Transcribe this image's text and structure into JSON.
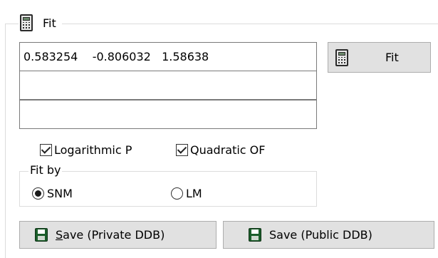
{
  "group": {
    "title": "Fit"
  },
  "fields": [
    {
      "value": "0.583254    -0.806032   1.58638"
    },
    {
      "value": ""
    },
    {
      "value": ""
    }
  ],
  "fit_button": {
    "label": "Fit"
  },
  "checkboxes": [
    {
      "label": "Logarithmic P",
      "checked": true
    },
    {
      "label": "Quadratic OF",
      "checked": true
    }
  ],
  "fit_by": {
    "title": "Fit by",
    "options": [
      {
        "label": "SNM",
        "selected": true
      },
      {
        "label": "LM",
        "selected": false
      }
    ]
  },
  "save_private": {
    "mnemonic": "S",
    "label_rest": "ave (Private DDB)"
  },
  "save_public": {
    "label": "Save (Public DDB)"
  },
  "colors": {
    "button_face": "#e1e1e1",
    "border": "#7a7a7a",
    "floppy": "#1b5e2b"
  }
}
